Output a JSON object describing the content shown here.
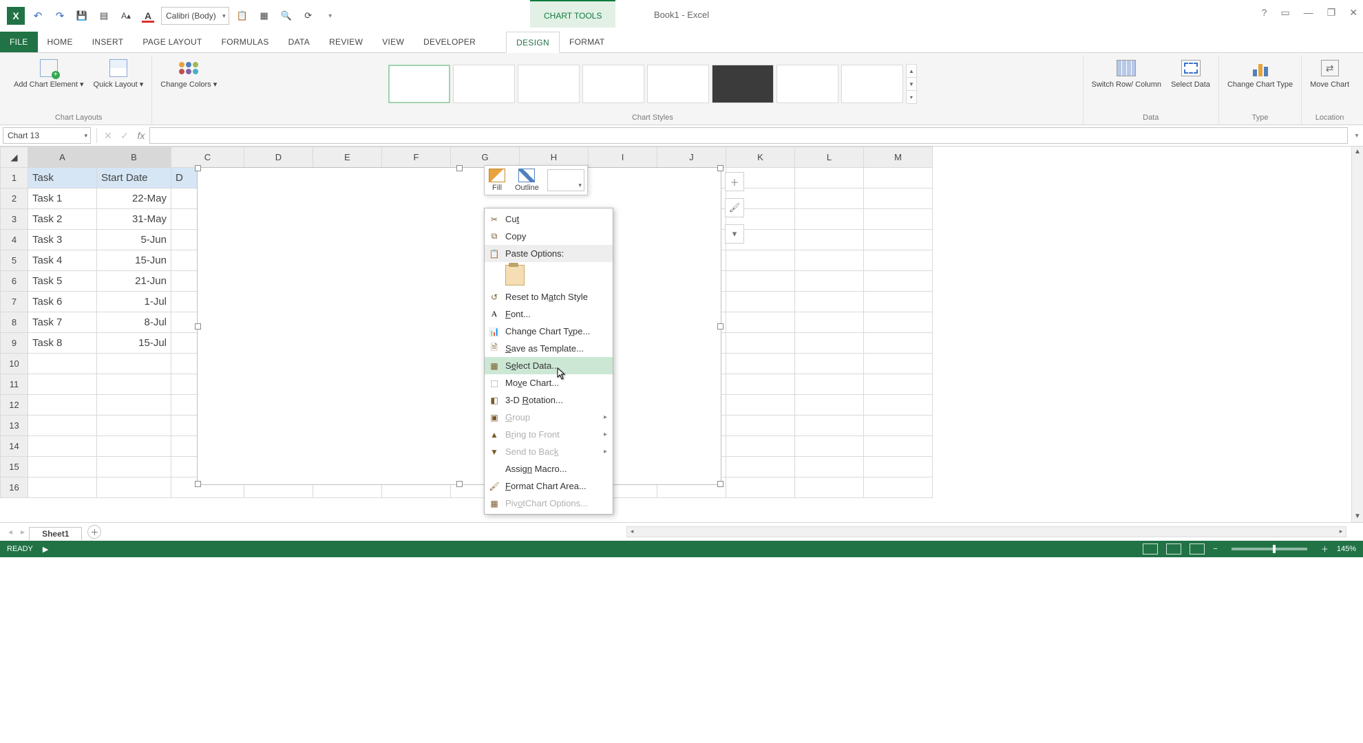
{
  "app": {
    "doc_title": "Book1 - Excel",
    "contextual_tab": "CHART TOOLS"
  },
  "qat": {
    "font_name": "Calibri (Body)"
  },
  "win": {
    "help": "?",
    "ribbon_opts": "▭",
    "min": "—",
    "restore": "❐",
    "close": "✕"
  },
  "tabs": {
    "file": "FILE",
    "home": "HOME",
    "insert": "INSERT",
    "page_layout": "PAGE LAYOUT",
    "formulas": "FORMULAS",
    "data": "DATA",
    "review": "REVIEW",
    "view": "VIEW",
    "developer": "DEVELOPER",
    "design": "DESIGN",
    "format": "FORMAT"
  },
  "ribbon": {
    "chart_layouts": {
      "add_element": "Add Chart Element ▾",
      "quick_layout": "Quick Layout ▾",
      "label": "Chart Layouts"
    },
    "change_colors": "Change Colors ▾",
    "chart_styles_label": "Chart Styles",
    "data": {
      "switch": "Switch Row/ Column",
      "select": "Select Data",
      "label": "Data"
    },
    "type": {
      "change": "Change Chart Type",
      "label": "Type"
    },
    "location": {
      "move": "Move Chart",
      "label": "Location"
    }
  },
  "formula_bar": {
    "name_box": "Chart 13",
    "fx": "fx"
  },
  "columns": [
    "A",
    "B",
    "C",
    "D",
    "E",
    "F",
    "G",
    "H",
    "I",
    "J",
    "K",
    "L",
    "M"
  ],
  "row_numbers": [
    "1",
    "2",
    "3",
    "4",
    "5",
    "6",
    "7",
    "8",
    "9",
    "10",
    "11",
    "12",
    "13",
    "14",
    "15",
    "16"
  ],
  "grid": {
    "header": {
      "a": "Task",
      "b": "Start Date",
      "c_partial": "D"
    },
    "rows": [
      {
        "a": "Task 1",
        "b": "22-May"
      },
      {
        "a": "Task 2",
        "b": "31-May"
      },
      {
        "a": "Task 3",
        "b": "5-Jun"
      },
      {
        "a": "Task 4",
        "b": "15-Jun"
      },
      {
        "a": "Task 5",
        "b": "21-Jun"
      },
      {
        "a": "Task 6",
        "b": "1-Jul"
      },
      {
        "a": "Task 7",
        "b": "8-Jul"
      },
      {
        "a": "Task 8",
        "b": "15-Jul"
      }
    ]
  },
  "mini_toolbar": {
    "fill": "Fill",
    "outline": "Outline"
  },
  "context_menu": {
    "cut": "Cut",
    "copy": "Copy",
    "paste_options": "Paste Options:",
    "reset": "Reset to Match Style",
    "font": "Font...",
    "change_chart_type": "Change Chart Type...",
    "save_template": "Save as Template...",
    "select_data": "Select Data...",
    "move_chart": "Move Chart...",
    "rotation": "3-D Rotation...",
    "group": "Group",
    "bring_front": "Bring to Front",
    "send_back": "Send to Back",
    "assign_macro": "Assign Macro...",
    "format_chart": "Format Chart Area...",
    "pivot_options": "PivotChart Options..."
  },
  "sheet_tabs": {
    "sheet1": "Sheet1"
  },
  "status_bar": {
    "ready": "READY",
    "zoom": "145%"
  }
}
